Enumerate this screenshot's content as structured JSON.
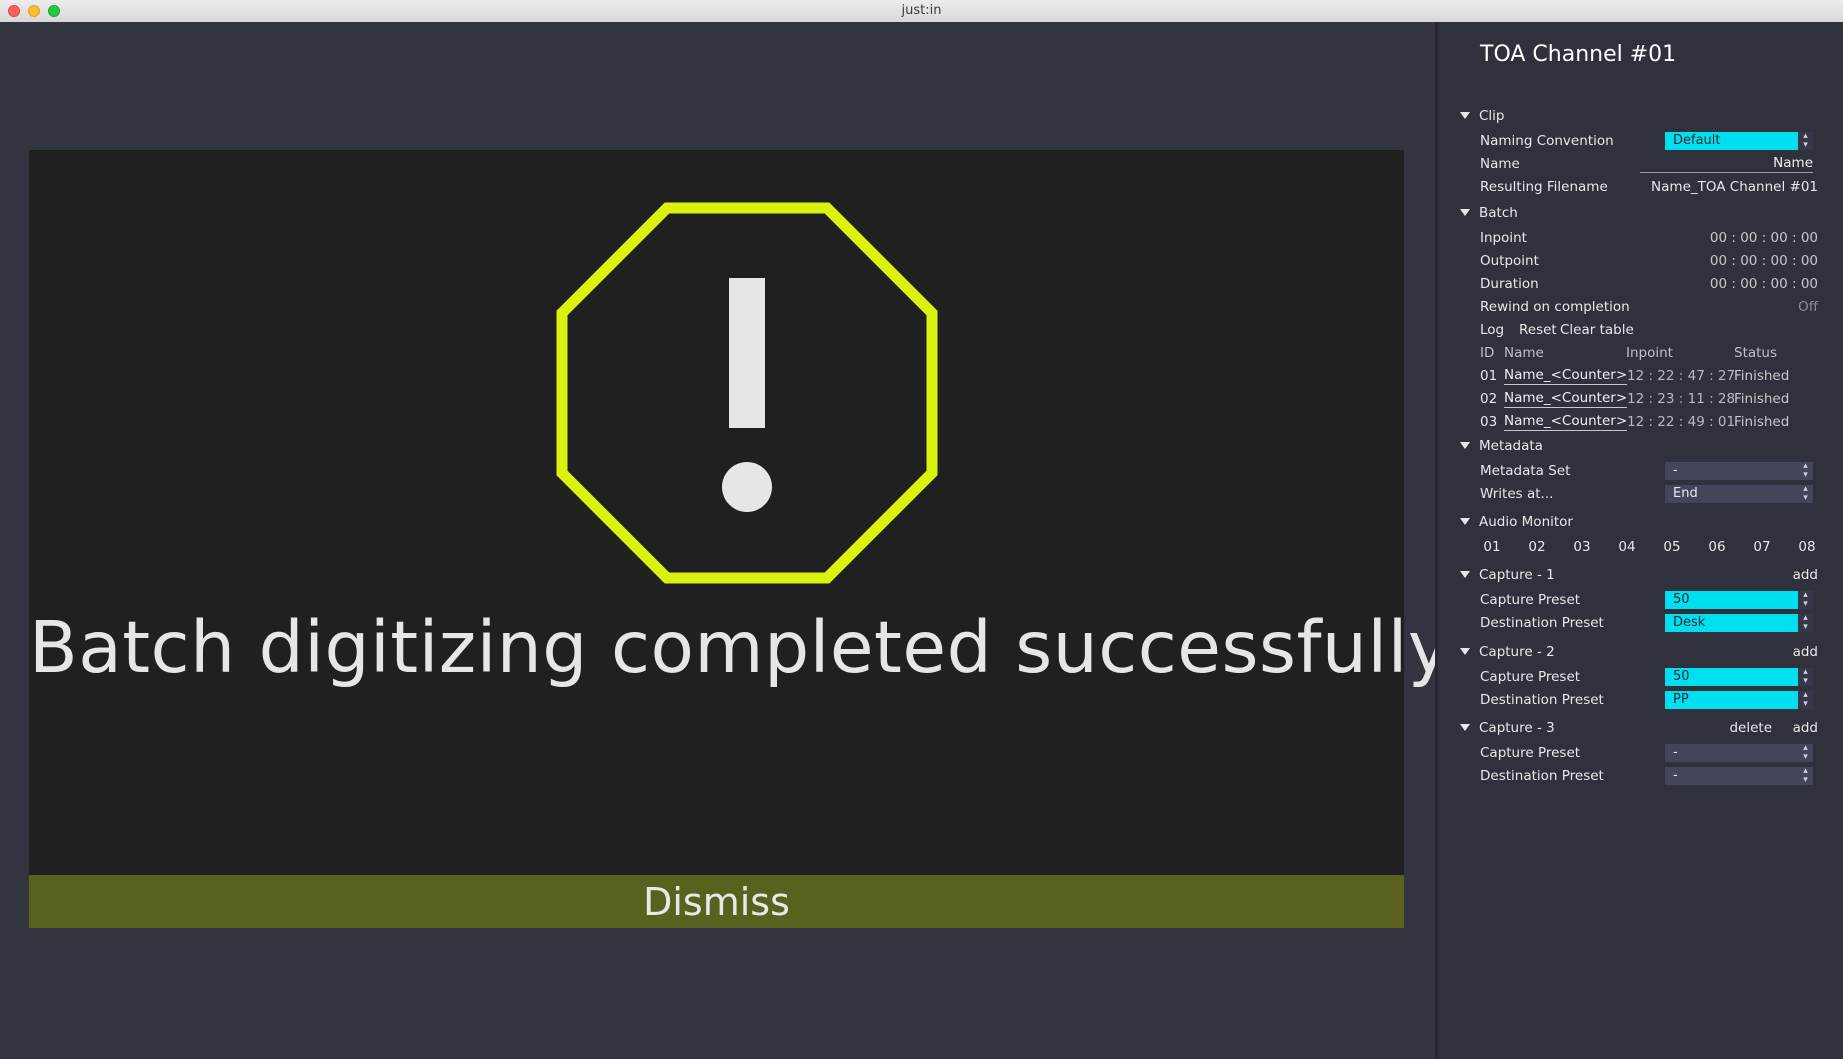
{
  "window": {
    "title": "just:in"
  },
  "dialog": {
    "message": "Batch digitizing completed successfully!",
    "dismiss_label": "Dismiss",
    "icon": "warning-octagon-icon",
    "icon_color": "#d9f20f"
  },
  "panel": {
    "title": "TOA Channel #01",
    "clip": {
      "section": "Clip",
      "naming_label": "Naming Convention",
      "naming_value": "Default",
      "name_label": "Name",
      "name_value": "Name",
      "resulting_label": "Resulting Filename",
      "resulting_value": "Name_TOA Channel #01"
    },
    "batch": {
      "section": "Batch",
      "inpoint_label": "Inpoint",
      "inpoint_value": "00 : 00 : 00 : 00",
      "outpoint_label": "Outpoint",
      "outpoint_value": "00 : 00 : 00 : 00",
      "duration_label": "Duration",
      "duration_value": "00 : 00 : 00 : 00",
      "rewind_label": "Rewind on completion",
      "rewind_value": "Off",
      "log_label": "Log",
      "reset_label": "Reset",
      "clear_label": "Clear table",
      "headers": [
        "ID",
        "Name",
        "Inpoint",
        "Status"
      ],
      "rows": [
        {
          "id": "01",
          "name": "Name_<Counter>",
          "inpoint": "12 : 22 : 47 : 27",
          "status": "Finished"
        },
        {
          "id": "02",
          "name": "Name_<Counter>",
          "inpoint": "12 : 23 : 11 : 28",
          "status": "Finished"
        },
        {
          "id": "03",
          "name": "Name_<Counter>",
          "inpoint": "12 : 22 : 49 : 01",
          "status": "Finished"
        }
      ]
    },
    "metadata": {
      "section": "Metadata",
      "set_label": "Metadata Set",
      "set_value": "-",
      "writes_label": "Writes at...",
      "writes_value": "End"
    },
    "audio": {
      "section": "Audio Monitor",
      "channels": [
        "01",
        "02",
        "03",
        "04",
        "05",
        "06",
        "07",
        "08"
      ]
    },
    "captures": [
      {
        "section": "Capture - 1",
        "add": "add",
        "capture_label": "Capture Preset",
        "capture_value": "50",
        "dest_label": "Destination Preset",
        "dest_value": "Desk"
      },
      {
        "section": "Capture - 2",
        "add": "add",
        "capture_label": "Capture Preset",
        "capture_value": "50",
        "dest_label": "Destination Preset",
        "dest_value": "PP"
      },
      {
        "section": "Capture - 3",
        "delete": "delete",
        "add": "add",
        "capture_label": "Capture Preset",
        "capture_value": "-",
        "dest_label": "Destination Preset",
        "dest_value": "-"
      }
    ],
    "colors": {
      "accent": "#00dff0",
      "panel_bg": "#2f313c",
      "main_bg": "#323440",
      "dismiss_bg": "#5a611e"
    }
  }
}
